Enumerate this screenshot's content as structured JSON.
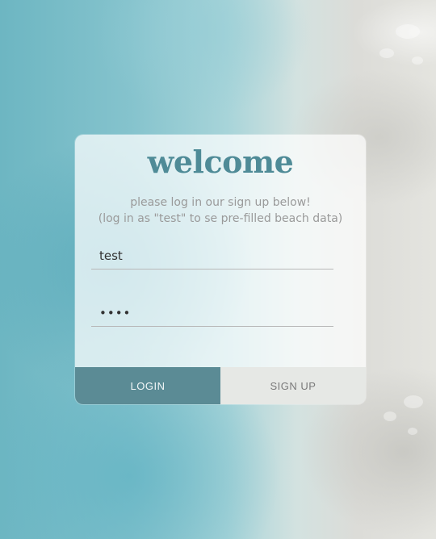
{
  "card": {
    "title": "welcome",
    "subtitle_line1": "please log in our sign up below!",
    "subtitle_line2": "(log in as \"test\" to se pre-filled beach data)"
  },
  "form": {
    "username_value": "test",
    "password_value": "test"
  },
  "buttons": {
    "login_label": "LOGIN",
    "signup_label": "SIGN UP"
  },
  "colors": {
    "accent": "#4f8b97",
    "login_button": "#5b8b95",
    "signup_button": "#e6e8e5"
  }
}
